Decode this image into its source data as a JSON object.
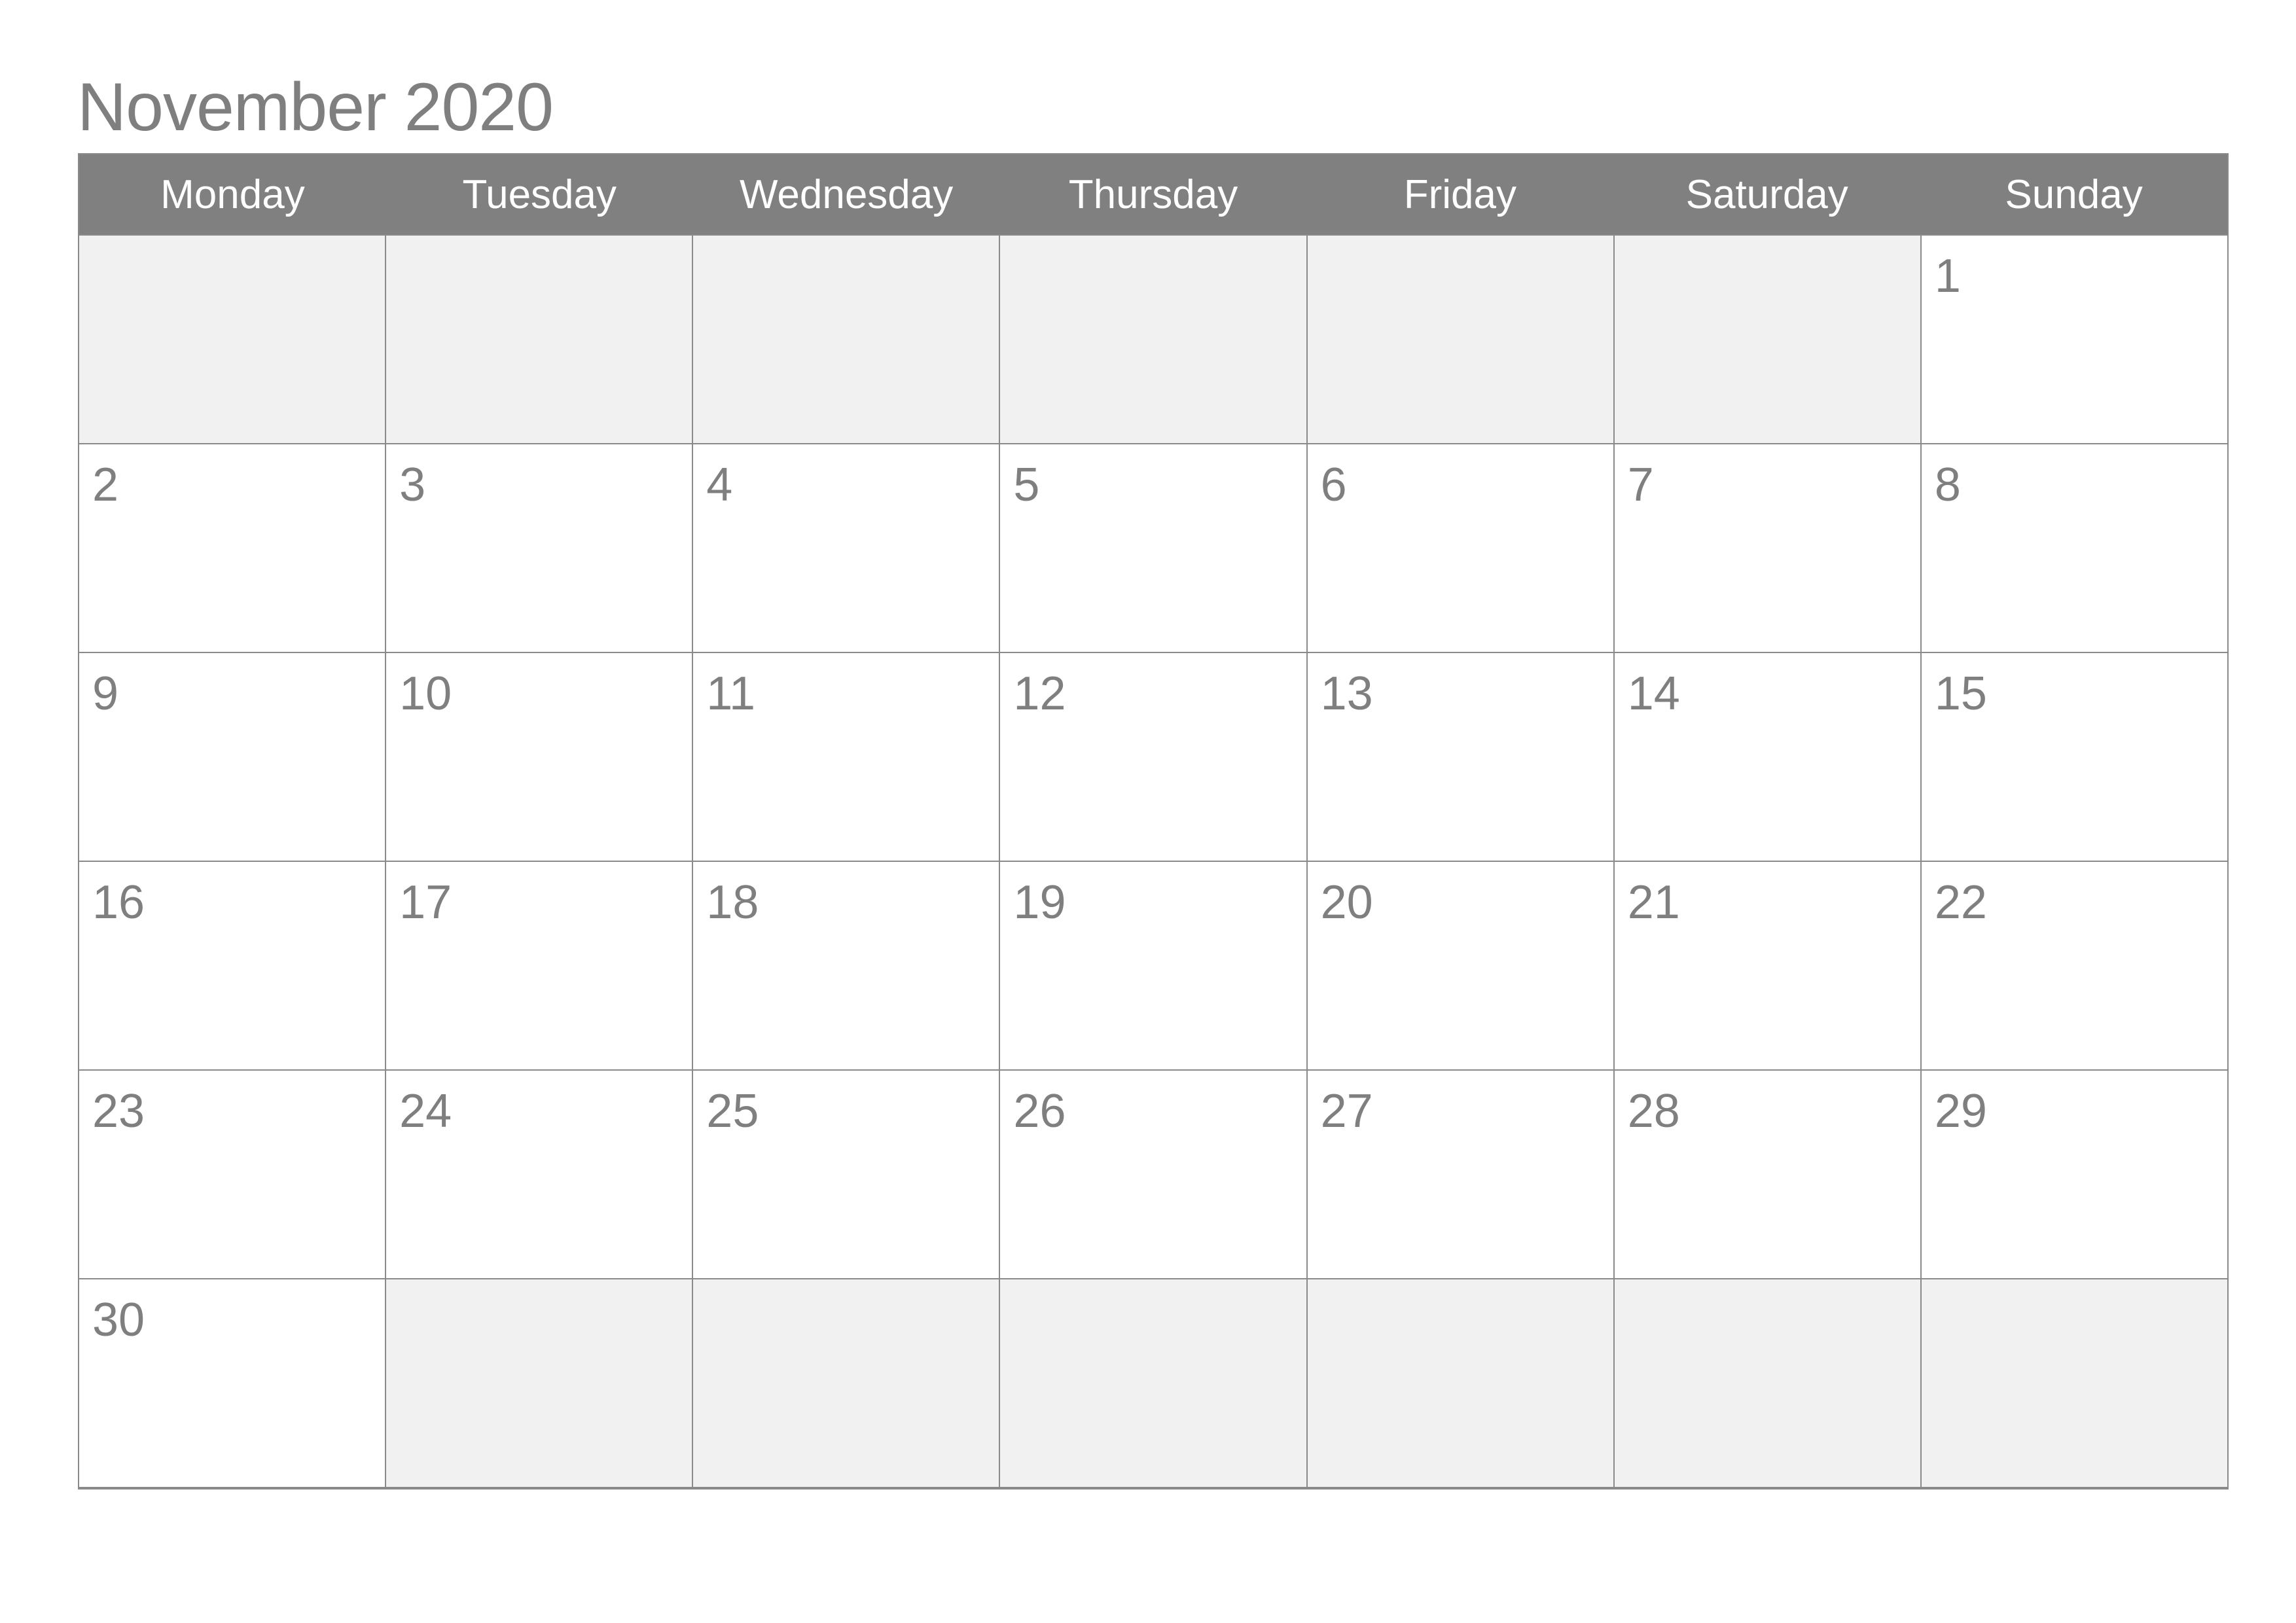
{
  "title": "November 2020",
  "weekdays": [
    "Monday",
    "Tuesday",
    "Wednesday",
    "Thursday",
    "Friday",
    "Saturday",
    "Sunday"
  ],
  "weeks": [
    [
      "",
      "",
      "",
      "",
      "",
      "",
      "1"
    ],
    [
      "2",
      "3",
      "4",
      "5",
      "6",
      "7",
      "8"
    ],
    [
      "9",
      "10",
      "11",
      "12",
      "13",
      "14",
      "15"
    ],
    [
      "16",
      "17",
      "18",
      "19",
      "20",
      "21",
      "22"
    ],
    [
      "23",
      "24",
      "25",
      "26",
      "27",
      "28",
      "29"
    ],
    [
      "30",
      "",
      "",
      "",
      "",
      "",
      ""
    ]
  ],
  "colors": {
    "header_bg": "#808080",
    "empty_cell": "#f1f1f1",
    "text": "#7f7f7f"
  }
}
